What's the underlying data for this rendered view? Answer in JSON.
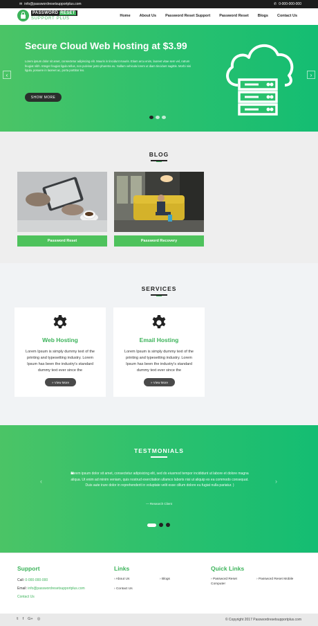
{
  "topbar": {
    "email": "info@passwordresetsupportplus.com",
    "phone": "0-000-000-000"
  },
  "logo": {
    "line1a": "PASSWORD",
    "line1b": "RESET",
    "line2": "SUPPORT PLUS"
  },
  "nav": {
    "items": [
      "Home",
      "About Us",
      "Password Reset Support",
      "Password Reset",
      "Blogs",
      "Contact Us"
    ]
  },
  "hero": {
    "title": "Secure Cloud Web Hosting at $3.99",
    "body": "Lorem ipsum dolor sit amet, consectetur adipiscing elit. Mauris in tincidunt mauris. Etiam arcu enim, laoreet vitae sem vel, rutrum feugiat nibh. Integer feugiat ligula tellus, non pulvinar justo pharetra eu. Nullam vehicula lorem ut diam tincidunt sagittis. Morbi nisi ligula, posuere in laoreet ac, porta porttitor leo.",
    "button": "SHOW MORE",
    "prev": "‹",
    "next": "›"
  },
  "blog": {
    "title": "BLOG",
    "cards": [
      {
        "caption": "Password Reset"
      },
      {
        "caption": "Password Recovery"
      }
    ]
  },
  "services": {
    "title": "SERVICES",
    "items": [
      {
        "title": "Web Hosting",
        "text": "Lorem Ipsum is simply dummy text of the printing and typesetting industry. Lorem Ipsum has been the industry's standard dummy text ever since the",
        "button": "» View More"
      },
      {
        "title": "Email Hosting",
        "text": "Lorem Ipsum is simply dummy text of the printing and typesetting industry. Lorem Ipsum has been the industry's standard dummy text ever since the",
        "button": "» View More"
      }
    ]
  },
  "testimonials": {
    "title": "TESTMONIALS",
    "quote_mark": "❝",
    "text": "Lorem ipsum dolor sit amet, consectetur adipisicing elit, sed do eiusmod tempor incididunt ut labore et dolore magna aliqua. Ut enim ad minim veniam, quis nostrud exercitation ullamco laboris nisi ut aliquip ex ea commodo consequat. Duis aute irure dolor in reprehenderit in voluptate velit esse cillum dolore eu fugiat nulla pariatur. )",
    "author": "— Research Client",
    "prev": "‹",
    "next": "›"
  },
  "footer": {
    "support": {
      "title": "Support",
      "call_label": "Call:",
      "call_value": "0-000-000-000",
      "email_label": "Email:",
      "email_value": "info@passwordresetsupportplus.com",
      "contact": "Contact Us"
    },
    "links": {
      "title": "Links",
      "items": [
        "About Us",
        "Blogs",
        "Contact Us"
      ]
    },
    "quick": {
      "title": "Quick Links",
      "items": [
        "Password Reset Computer",
        "Password Reset Mobile"
      ]
    },
    "social": [
      "𝕥",
      "f",
      "G+",
      "◎"
    ],
    "copyright": "© Copyright 2017 Passwordresetsupportplus.com"
  },
  "colors": {
    "accent": "#3cb35a",
    "dark": "#1c1c1c"
  }
}
